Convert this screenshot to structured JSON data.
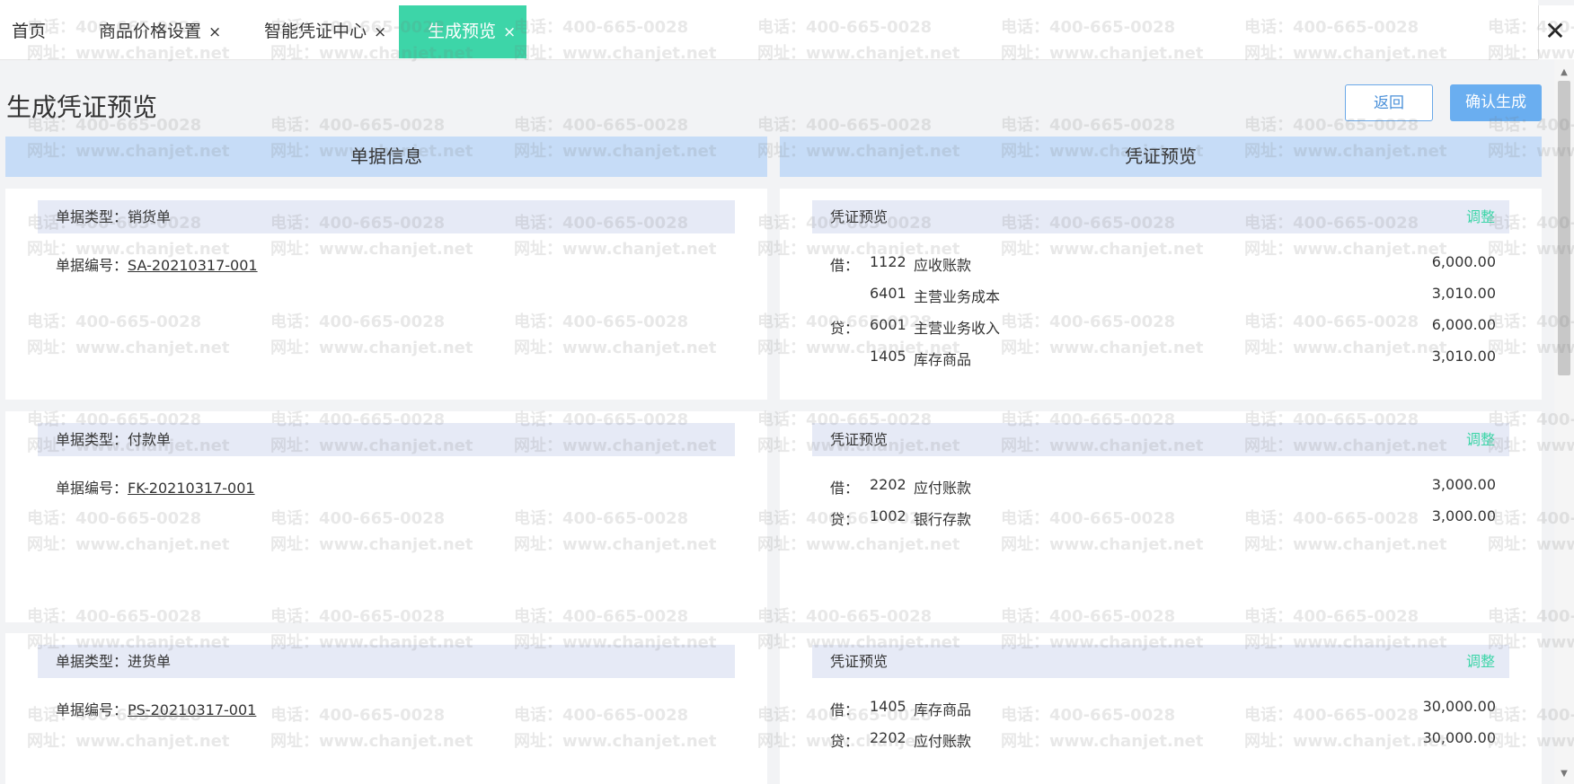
{
  "tabs": [
    {
      "label": "首页",
      "closable": false
    },
    {
      "label": "商品价格设置",
      "closable": true
    },
    {
      "label": "智能凭证中心",
      "closable": true
    },
    {
      "label": "生成预览",
      "closable": true,
      "active": true
    }
  ],
  "tab_close_glyph": "×",
  "window_close_glyph": "✕",
  "page_title": "生成凭证预览",
  "buttons": {
    "back": "返回",
    "confirm": "确认生成"
  },
  "columns": {
    "left": "单据信息",
    "right": "凭证预览"
  },
  "adjust_label": "调整",
  "voucher_head": "凭证预览",
  "doc_type_prefix": "单据类型：",
  "doc_no_prefix": "单据编号：",
  "records": [
    {
      "doc_type": "销货单",
      "doc_no": "SA-20210317-001",
      "entries": [
        {
          "dc": "借：",
          "code": "1122",
          "account": "应收账款",
          "amount": "6,000.00"
        },
        {
          "dc": "",
          "code": "6401",
          "account": "主营业务成本",
          "amount": "3,010.00"
        },
        {
          "dc": "贷：",
          "code": "6001",
          "account": "主营业务收入",
          "amount": "6,000.00"
        },
        {
          "dc": "",
          "code": "1405",
          "account": "库存商品",
          "amount": "3,010.00"
        }
      ]
    },
    {
      "doc_type": "付款单",
      "doc_no": "FK-20210317-001",
      "entries": [
        {
          "dc": "借：",
          "code": "2202",
          "account": "应付账款",
          "amount": "3,000.00"
        },
        {
          "dc": "贷：",
          "code": "1002",
          "account": "银行存款",
          "amount": "3,000.00"
        }
      ]
    },
    {
      "doc_type": "进货单",
      "doc_no": "PS-20210317-001",
      "entries": [
        {
          "dc": "借：",
          "code": "1405",
          "account": "库存商品",
          "amount": "30,000.00"
        },
        {
          "dc": "贷：",
          "code": "2202",
          "account": "应付账款",
          "amount": "30,000.00"
        }
      ]
    }
  ],
  "watermark": {
    "phone": "电话：400-665-0028",
    "site": "网址：www.chanjet.net"
  },
  "colors": {
    "active_tab": "#3dd5a8",
    "section_header": "#c6dcf7",
    "card_head": "#e6eaf6",
    "link": "#3dd5a8",
    "primary_button": "#6aaef0"
  }
}
